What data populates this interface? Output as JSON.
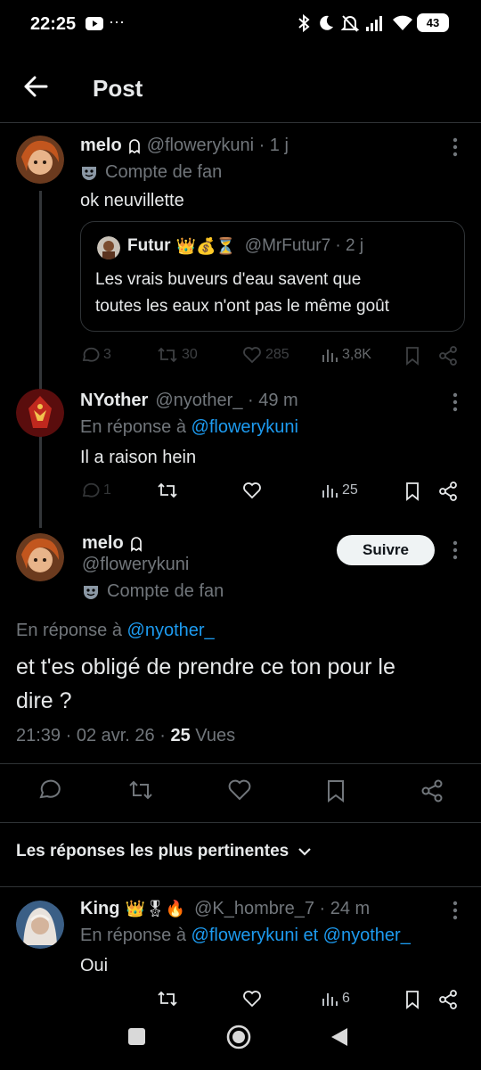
{
  "status_bar": {
    "time": "22:25",
    "dots": "···",
    "battery": "43"
  },
  "header": {
    "title": "Post"
  },
  "parent_post": {
    "name": "melo",
    "handle": "@flowerykuni · 1 j",
    "label": "Compte de fan",
    "text": "ok neuvillette",
    "quote": {
      "name": "Futur",
      "emojis": "👑💰⏳",
      "handle": "@MrFutur7 · 2 j",
      "text_line1": "Les vrais buveurs d'eau savent que",
      "text_line2": "toutes les eaux n'ont pas le même goût"
    },
    "stats": {
      "replies": "3",
      "reposts": "30",
      "likes": "285",
      "views": "3,8K"
    }
  },
  "reply_nyother": {
    "name": "NYother",
    "handle": "@nyother_ · 49 m",
    "in_reply_prefix": "En réponse à",
    "in_reply_to": "@flowerykuni",
    "text": "Il a raison hein",
    "stats": {
      "replies": "1",
      "views": "25"
    }
  },
  "main_post": {
    "name": "melo",
    "handle": "@flowerykuni",
    "label": "Compte de fan",
    "follow_label": "Suivre",
    "in_reply_prefix": "En réponse à",
    "in_reply_to": "@nyother_",
    "text_line1": "et t'es obligé de prendre ce ton pour le",
    "text_line2": "dire ?",
    "time": "21:39 · 02 avr. 26 ·",
    "views_count": "25",
    "views_label": "Vues"
  },
  "sort": {
    "label": "Les réponses les plus pertinentes"
  },
  "reply_king": {
    "name": "King",
    "emojis": "👑🎖🔥",
    "handle": "@K_hombre_7 · 24 m",
    "in_reply_prefix": "En réponse à",
    "in_reply_to": "@flowerykuni et @nyother_",
    "text": "Oui",
    "stats": {
      "views": "6"
    }
  },
  "colors": {
    "accent": "#1d9bf0",
    "muted": "#71767b",
    "text": "#e7e9ea",
    "divider": "#2f3336"
  }
}
